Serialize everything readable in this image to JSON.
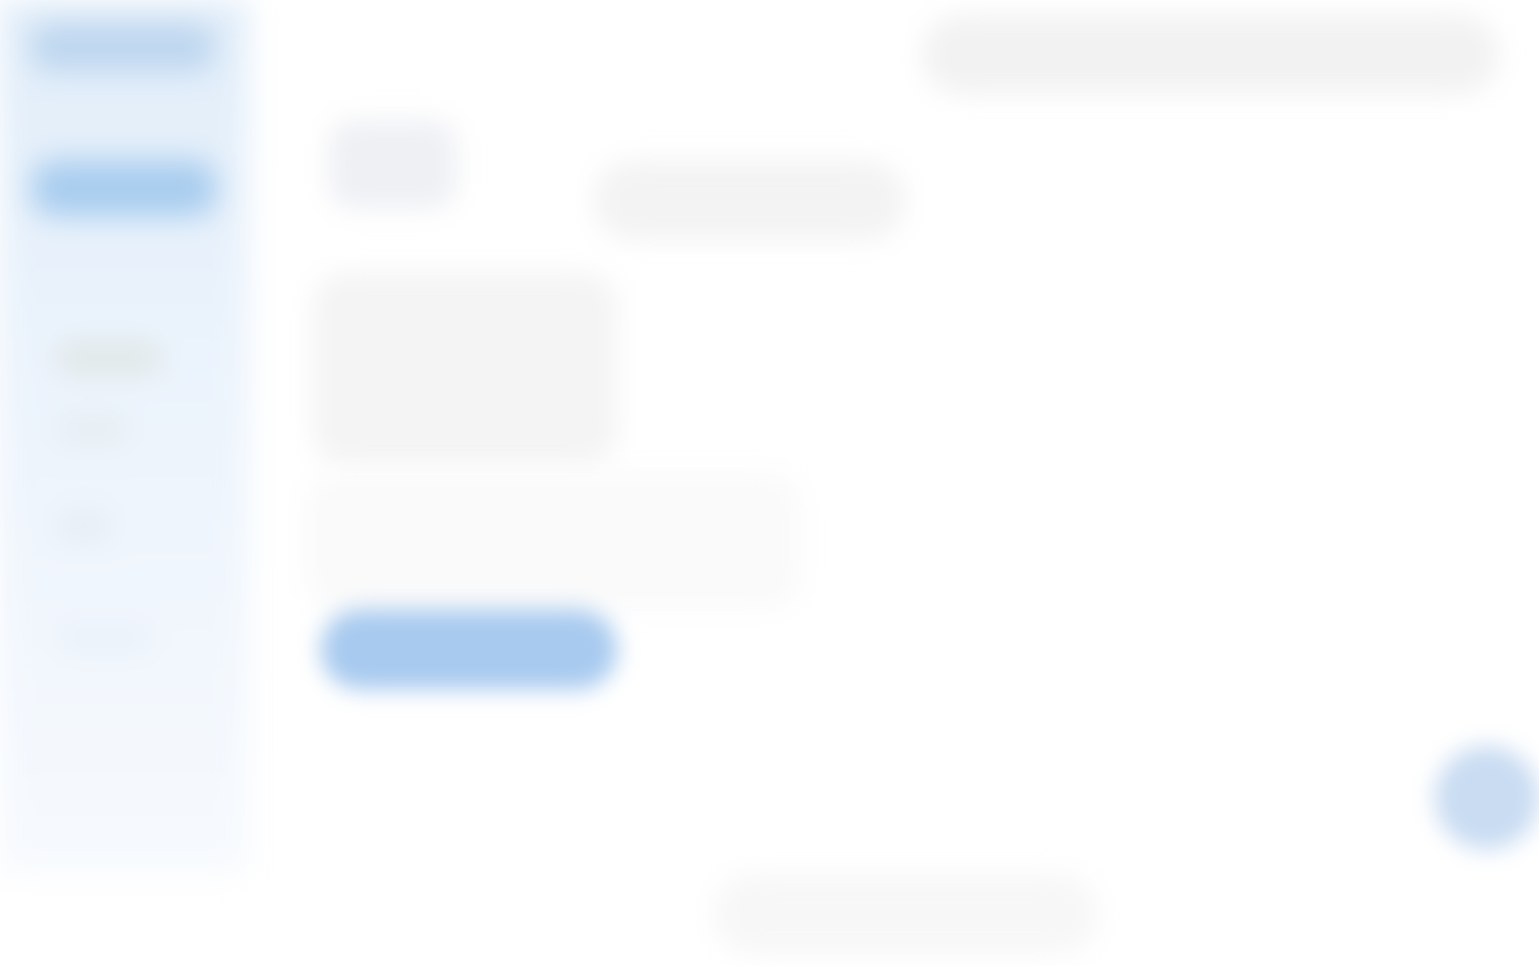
{
  "sidebar": {
    "items": [
      {
        "label": ""
      },
      {
        "label": ""
      },
      {
        "label": ""
      },
      {
        "label": ""
      },
      {
        "label": ""
      },
      {
        "label": ""
      }
    ]
  },
  "header": {
    "search_placeholder": ""
  },
  "main": {
    "title": "",
    "filter_label": "",
    "card_text": "",
    "body_text": "",
    "primary_button_label": ""
  },
  "fab": {
    "icon": "plus-icon"
  },
  "footer": {
    "text": ""
  },
  "colors": {
    "accent": "#a8caef",
    "sidebar_bg": "#e8f1fb"
  }
}
